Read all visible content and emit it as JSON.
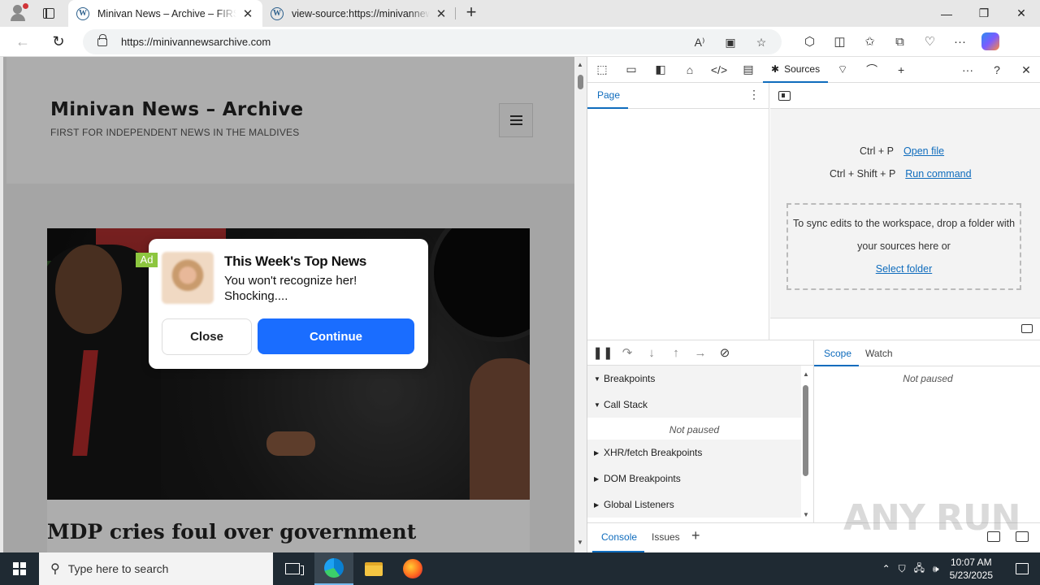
{
  "browser": {
    "tabs": [
      {
        "title": "Minivan News – Archive – FIRST FOR INDEPENDENT NEWS IN THE MALDIVES",
        "close": "✕"
      },
      {
        "title": "view-source:https://minivannewsarchive.com",
        "close": "✕"
      }
    ],
    "new_tab": "+",
    "url": "https://minivannewsarchive.com"
  },
  "site": {
    "title": "Minivan News – Archive",
    "tagline": "FIRST FOR INDEPENDENT NEWS IN THE MALDIVES",
    "headline": "MDP cries foul over government"
  },
  "ad": {
    "tag": "Ad",
    "title": "This Week's Top News",
    "body": "You won't recognize her! Shocking....",
    "close_label": "Close",
    "continue_label": "Continue"
  },
  "devtools": {
    "active_tool": "Sources",
    "navigator_tab": "Page",
    "shortcuts": [
      {
        "keys": "Ctrl + P",
        "action": "Open file"
      },
      {
        "keys": "Ctrl + Shift + P",
        "action": "Run command"
      }
    ],
    "dropzone_text": "To sync edits to the workspace, drop a folder with your sources here or",
    "dropzone_link": "Select folder",
    "sections": {
      "breakpoints": "Breakpoints",
      "call_stack": "Call Stack",
      "call_stack_status": "Not paused",
      "xhr": "XHR/fetch Breakpoints",
      "dom": "DOM Breakpoints",
      "global": "Global Listeners"
    },
    "scope_tab": "Scope",
    "watch_tab": "Watch",
    "scope_status": "Not paused",
    "drawer": {
      "console": "Console",
      "issues": "Issues"
    }
  },
  "watermark": "ANY RUN",
  "taskbar": {
    "search_placeholder": "Type here to search",
    "time": "10:07 AM",
    "date": "5/23/2025"
  }
}
